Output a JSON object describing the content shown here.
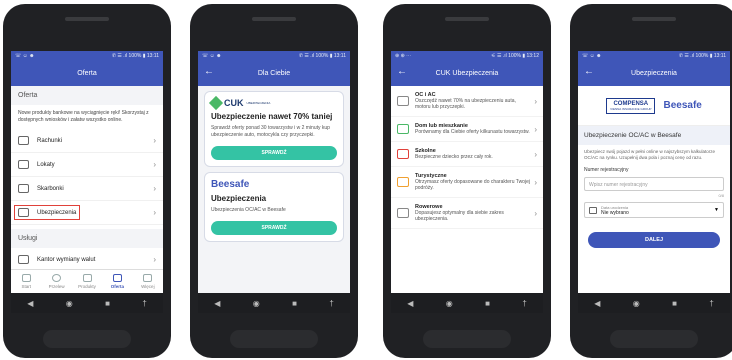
{
  "colors": {
    "header": "#3f56b8",
    "accent": "#34c3a4",
    "highlight": "#e0413a"
  },
  "status": {
    "s1_left": "☏ ☺ ☻",
    "s1_right": "✆ ☰ .ıl 100% ▮ 13:11",
    "s2_left": "☏ ☺ ☻",
    "s2_right": "✆ ☰ .ıl 100% ▮ 13:11",
    "s3_left": "⊕ ⊕ ⋯",
    "s3_right": "⚟ ☰ .ıl 100% ▮ 13:12",
    "s4_left": "☏ ☺ ☻",
    "s4_right": "✆ ☰ .ıl 100% ▮ 13:11"
  },
  "screen1": {
    "title": "Oferta",
    "section": "Oferta",
    "intro": "Nowe produkty bankowe na wyciągnięcie ręki! Skorzystaj z dostępnych wniosków i załatw wszystko online.",
    "items": [
      {
        "label": "Rachunki",
        "icon": "wallet-icon"
      },
      {
        "label": "Lokaty",
        "icon": "piggy-icon"
      },
      {
        "label": "Skarbonki",
        "icon": "jar-icon"
      },
      {
        "label": "Ubezpieczenia",
        "icon": "car-insurance-icon"
      }
    ],
    "section2": "Usługi",
    "service": "Kantor wymiany walut",
    "tabs": [
      "Start",
      "Przelew",
      "Produkty",
      "Oferta",
      "Więcej"
    ]
  },
  "screen2": {
    "title": "Dla Ciebie",
    "card1_logo": "CUK",
    "card1_logo_sub": "UBEZPIECZENIA",
    "card1_title": "Ubezpieczenie nawet 70% taniej",
    "card1_text": "Sprawdź oferty ponad 30 towarzystw i w 2 minuty kup ubezpieczenie auto, motocykla czy przyczepki.",
    "card1_btn": "SPRAWDŹ",
    "card2_logo": "Beesafe",
    "card2_title": "Ubezpieczenia",
    "card2_text": "Ubezpieczenia OC/AC w Beesafe",
    "card2_btn": "SPRAWDŹ"
  },
  "screen3": {
    "title": "CUK Ubezpieczenia",
    "items": [
      {
        "title": "OC i AC",
        "desc": "Oszczędź nawet 70% na ubezpieczeniu auta, motoru lub przyczepki.",
        "icon": "car-icon"
      },
      {
        "title": "Dom lub mieszkanie",
        "desc": "Porównamy dla Ciebie oferty kilkunastu towarzystw.",
        "icon": "house-icon"
      },
      {
        "title": "Szkolne",
        "desc": "Bezpieczne dziecko przez cały rok.",
        "icon": "school-icon"
      },
      {
        "title": "Turystyczne",
        "desc": "Otrzymasz oferty dopasowane do charakteru Twojej podróży.",
        "icon": "plane-icon"
      },
      {
        "title": "Rowerowe",
        "desc": "Dopasujesz optymalny dla siebie zakres ubezpieczenia.",
        "icon": "bike-icon"
      }
    ]
  },
  "screen4": {
    "title": "Ubezpieczenia",
    "logo1": "COMPENSA",
    "logo1_sub": "VIENNA INSURANCE GROUP",
    "logo2": "Beesafe",
    "section": "Ubezpieczenie OC/AC w Beesafe",
    "intro": "Ubezpiecz swój pojazd w pełni online w najszybszym kalkulatorze OC/AC na rynku. Uzupełnij dwa pola i poznaj cenę od razu.",
    "reg_label": "Numer rejestracyjny",
    "reg_placeholder": "Wpisz numer rejestracyjny",
    "counter": "0/8",
    "date_label": "Data urodzenia",
    "date_value": "Nie wybrano",
    "btn": "DALEJ"
  },
  "nav": {
    "back": "◀",
    "home": "◉",
    "recent": "■",
    "extra": "†"
  }
}
